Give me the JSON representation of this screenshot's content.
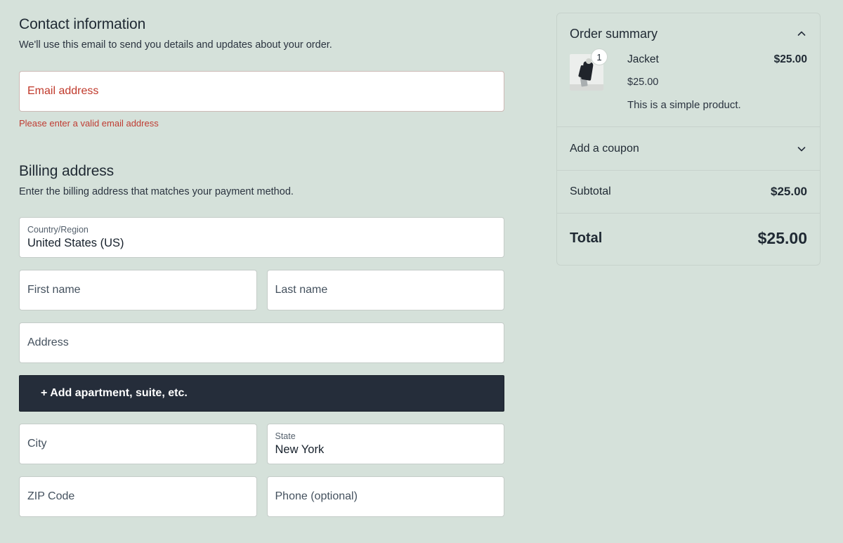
{
  "theme": {
    "background": "#d5e1da",
    "panel_border": "#c7d2cc",
    "field_background": "#ffffff",
    "field_border": "#c4ccc8",
    "text_primary": "#1f2933",
    "text_secondary": "#2b3440",
    "error_color": "#bf3c32",
    "dark_button_bg": "#252d3a"
  },
  "contact": {
    "title": "Contact information",
    "subtitle": "We'll use this email to send you details and updates about your order.",
    "email": {
      "placeholder": "Email address",
      "value": "",
      "error": "Please enter a valid email address"
    }
  },
  "billing": {
    "title": "Billing address",
    "subtitle": "Enter the billing address that matches your payment method.",
    "country": {
      "label": "Country/Region",
      "value": "United States (US)"
    },
    "first_name": {
      "placeholder": "First name",
      "value": ""
    },
    "last_name": {
      "placeholder": "Last name",
      "value": ""
    },
    "address": {
      "placeholder": "Address",
      "value": ""
    },
    "add_apartment_label": "+ Add apartment, suite, etc.",
    "city": {
      "placeholder": "City",
      "value": ""
    },
    "state": {
      "label": "State",
      "value": "New York"
    },
    "zip": {
      "placeholder": "ZIP Code",
      "value": ""
    },
    "phone": {
      "placeholder": "Phone (optional)",
      "value": ""
    }
  },
  "order_summary": {
    "title": "Order summary",
    "collapse_icon": "chevron-up-icon",
    "items": [
      {
        "name": "Jacket",
        "quantity": "1",
        "line_total": "$25.00",
        "unit_price": "$25.00",
        "description": "This is a simple product."
      }
    ],
    "coupon": {
      "label": "Add a coupon",
      "expand_icon": "chevron-down-icon"
    },
    "subtotal": {
      "label": "Subtotal",
      "amount": "$25.00"
    },
    "total": {
      "label": "Total",
      "amount": "$25.00"
    }
  }
}
